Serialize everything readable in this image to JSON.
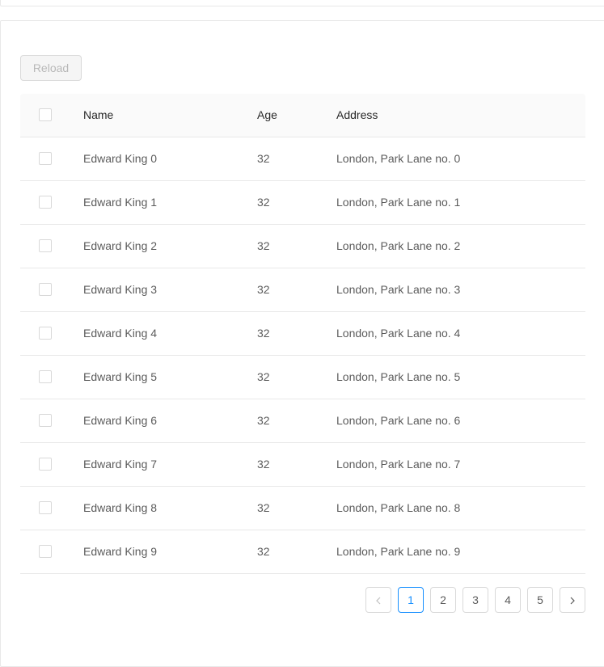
{
  "toolbar": {
    "reload_label": "Reload"
  },
  "table": {
    "columns": [
      "Name",
      "Age",
      "Address"
    ],
    "rows": [
      {
        "name": "Edward King 0",
        "age": "32",
        "address": "London, Park Lane no. 0"
      },
      {
        "name": "Edward King 1",
        "age": "32",
        "address": "London, Park Lane no. 1"
      },
      {
        "name": "Edward King 2",
        "age": "32",
        "address": "London, Park Lane no. 2"
      },
      {
        "name": "Edward King 3",
        "age": "32",
        "address": "London, Park Lane no. 3"
      },
      {
        "name": "Edward King 4",
        "age": "32",
        "address": "London, Park Lane no. 4"
      },
      {
        "name": "Edward King 5",
        "age": "32",
        "address": "London, Park Lane no. 5"
      },
      {
        "name": "Edward King 6",
        "age": "32",
        "address": "London, Park Lane no. 6"
      },
      {
        "name": "Edward King 7",
        "age": "32",
        "address": "London, Park Lane no. 7"
      },
      {
        "name": "Edward King 8",
        "age": "32",
        "address": "London, Park Lane no. 8"
      },
      {
        "name": "Edward King 9",
        "age": "32",
        "address": "London, Park Lane no. 9"
      }
    ]
  },
  "pagination": {
    "pages": [
      "1",
      "2",
      "3",
      "4",
      "5"
    ],
    "current": "1",
    "prev_icon": "chevron-left-icon",
    "next_icon": "chevron-right-icon"
  }
}
